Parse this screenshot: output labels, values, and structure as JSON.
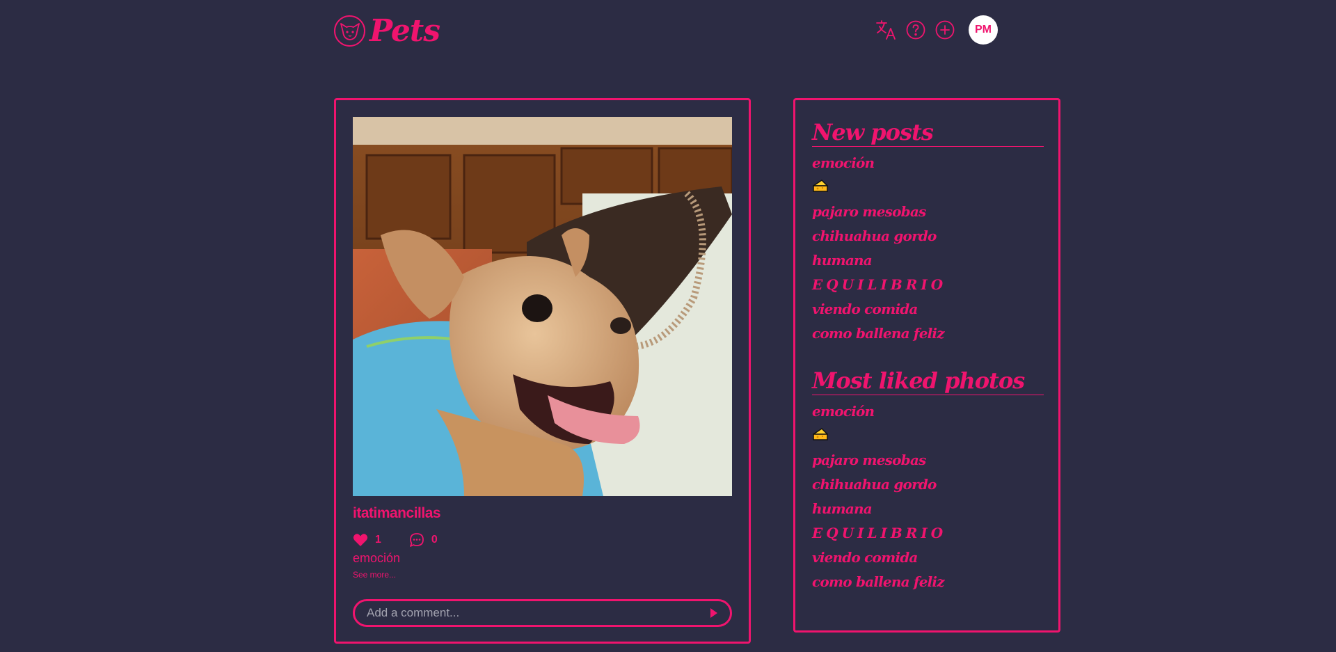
{
  "header": {
    "logo_text": "Pets",
    "avatar_initials": "PM",
    "icons": [
      "pet-face-icon",
      "translate-icon",
      "help-icon",
      "add-icon"
    ]
  },
  "post": {
    "author": "itatimancillas",
    "likes": "1",
    "comments": "0",
    "caption": "emoción",
    "see_more": "See more...",
    "comment_placeholder": "Add a comment..."
  },
  "sidebar": {
    "new_posts_title": "New posts",
    "most_liked_title": "Most liked photos",
    "new_posts": [
      "emoción",
      "🧀",
      "pajaro mesobas",
      "chihuahua gordo",
      "humana",
      "EQUILIBRIO",
      "viendo comida",
      "como ballena feliz"
    ],
    "most_liked": [
      "emoción",
      "🧀",
      "pajaro mesobas",
      "chihuahua gordo",
      "humana",
      "EQUILIBRIO",
      "viendo comida",
      "como ballena feliz"
    ]
  },
  "colors": {
    "background": "#2c2c44",
    "accent": "#f0146e",
    "avatar_bg": "#ffffff"
  }
}
